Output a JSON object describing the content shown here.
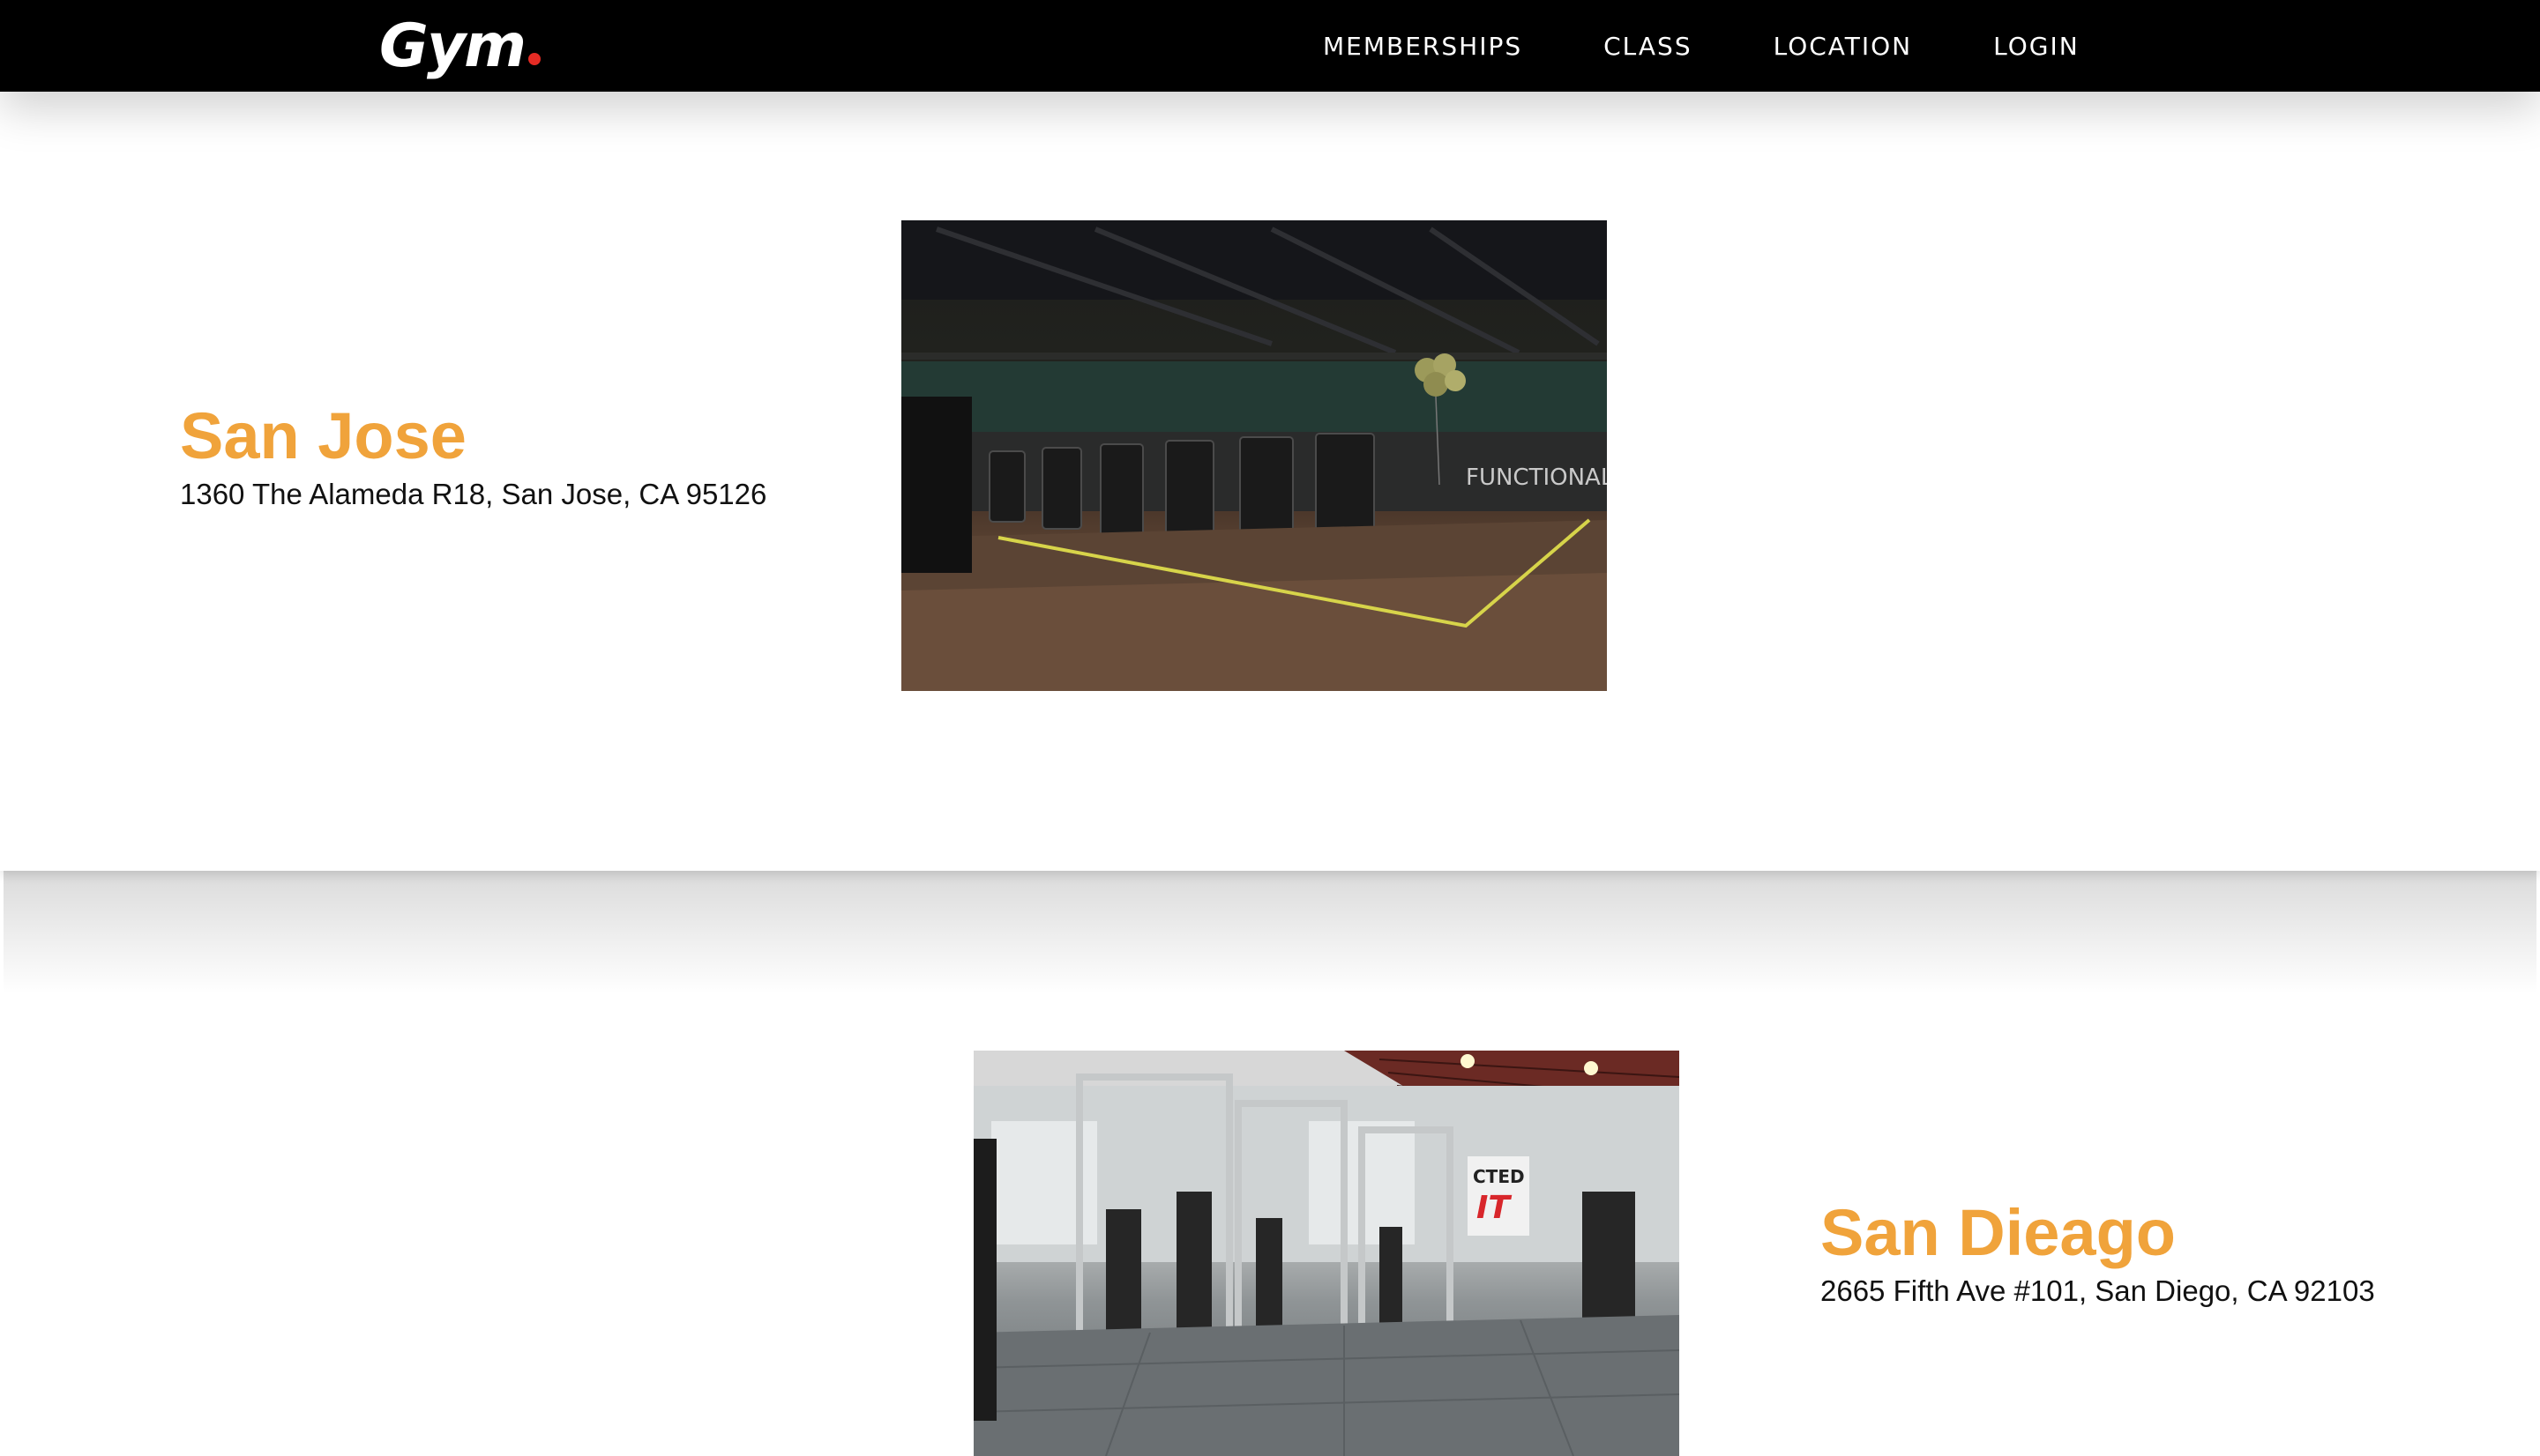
{
  "brand": {
    "logo_text": "Gym",
    "accent_color": "#e52b24"
  },
  "nav": {
    "items": [
      {
        "label": "MEMBERSHIPS"
      },
      {
        "label": "CLASS"
      },
      {
        "label": "LOCATION"
      },
      {
        "label": "LOGIN"
      }
    ]
  },
  "theme": {
    "heading_color": "#f0a33b",
    "nav_bg": "#000000"
  },
  "locations": [
    {
      "name": "San Jose",
      "address": "1360 The Alameda R18, San Jose, CA 95126",
      "image_alt": "dark-gym-treadmills-photo"
    },
    {
      "name": "San Dieago",
      "address": "2665 Fifth Ave #101, San Diego, CA 92103",
      "image_alt": "bright-gym-cable-machines-photo"
    }
  ]
}
